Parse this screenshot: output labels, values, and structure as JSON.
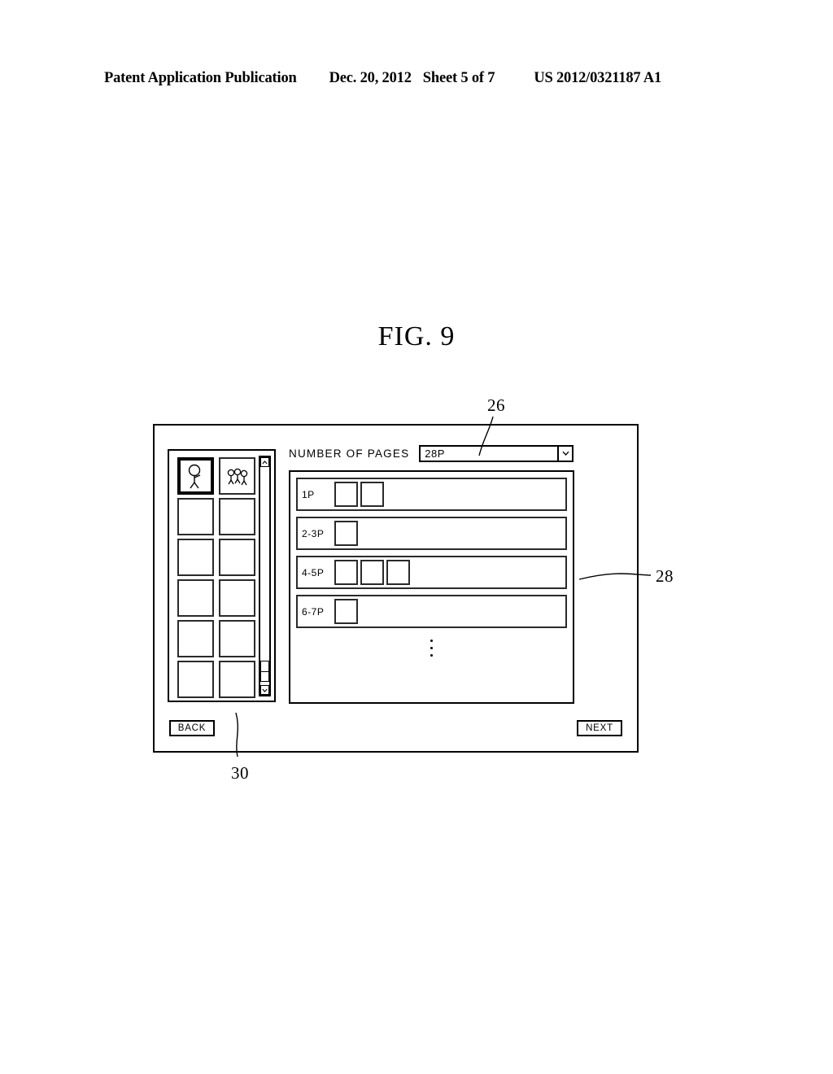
{
  "header": {
    "publication": "Patent Application Publication",
    "date": "Dec. 20, 2012",
    "sheet": "Sheet 5 of 7",
    "patent_number": "US 2012/0321187 A1"
  },
  "figure": {
    "title": "FIG. 9"
  },
  "reference_numerals": {
    "dropdown": "26",
    "list_panel": "28",
    "thumbnail_panel": "30"
  },
  "window": {
    "pages_selector": {
      "label": "NUMBER OF PAGES",
      "value": "28P",
      "arrow_icon": "chevron-down-icon"
    },
    "thumbnail_panel": {
      "scrollbar": {
        "up_icon": "chevron-up-icon",
        "down_icon": "chevron-down-icon"
      },
      "thumbnails": [
        {
          "index": 1,
          "selected": true,
          "art": "single-person"
        },
        {
          "index": 2,
          "selected": false,
          "art": "group-of-people"
        },
        {
          "index": 3,
          "selected": false,
          "art": ""
        },
        {
          "index": 4,
          "selected": false,
          "art": ""
        },
        {
          "index": 5,
          "selected": false,
          "art": ""
        },
        {
          "index": 6,
          "selected": false,
          "art": ""
        },
        {
          "index": 7,
          "selected": false,
          "art": ""
        },
        {
          "index": 8,
          "selected": false,
          "art": ""
        },
        {
          "index": 9,
          "selected": false,
          "art": ""
        },
        {
          "index": 10,
          "selected": false,
          "art": ""
        },
        {
          "index": 11,
          "selected": false,
          "art": ""
        },
        {
          "index": 12,
          "selected": false,
          "art": ""
        }
      ]
    },
    "spread_list": {
      "rows": [
        {
          "label": "1P",
          "slots": 2
        },
        {
          "label": "2-3P",
          "slots": 1
        },
        {
          "label": "4-5P",
          "slots": 3
        },
        {
          "label": "6-7P",
          "slots": 1
        }
      ],
      "continuation": "vertical-ellipsis"
    },
    "buttons": {
      "back": "BACK",
      "next": "NEXT"
    }
  }
}
